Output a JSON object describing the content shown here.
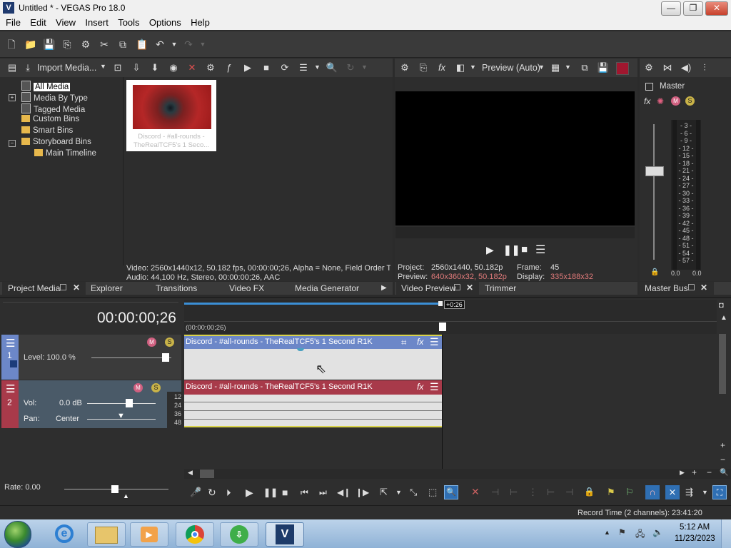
{
  "window": {
    "title": "Untitled * - VEGAS Pro 18.0",
    "app_icon": "V",
    "minimize": "—",
    "maximize": "❐",
    "close": "✕"
  },
  "menu": [
    "File",
    "Edit",
    "View",
    "Insert",
    "Tools",
    "Options",
    "Help"
  ],
  "project_media": {
    "import_label": "Import Media...",
    "tree": [
      {
        "label": "All Media",
        "selected": true
      },
      {
        "label": "Media By Type",
        "expander": "+"
      },
      {
        "label": "Tagged Media"
      },
      {
        "label": "Custom Bins"
      },
      {
        "label": "Smart Bins"
      },
      {
        "label": "Storyboard Bins",
        "expander": "−"
      },
      {
        "label": "Main Timeline"
      }
    ],
    "thumbnail_caption": "Discord - #all-rounds - TheRealTCF5's 1 Seco...",
    "info_video": "Video: 2560x1440x12, 50.182 fps, 00:00:00;26, Alpha = None, Field Order T",
    "info_audio": "Audio: 44,100 Hz, Stereo, 00:00:00;26, AAC"
  },
  "tabs_left": [
    "Project Media",
    "Explorer",
    "Transitions",
    "Video FX",
    "Media Generator"
  ],
  "preview": {
    "mode": "Preview (Auto)",
    "project_label": "Project:",
    "project_value": "2560x1440, 50.182p",
    "preview_label": "Preview:",
    "preview_value": "640x360x32, 50.182p",
    "frame_label": "Frame:",
    "frame_value": "45",
    "display_label": "Display:",
    "display_value": "335x188x32"
  },
  "tabs_mid": [
    "Video Preview",
    "Trimmer"
  ],
  "master": {
    "label": "Master",
    "scale": [
      "3",
      "6",
      "9",
      "12",
      "15",
      "18",
      "21",
      "24",
      "27",
      "30",
      "33",
      "36",
      "39",
      "42",
      "45",
      "48",
      "51",
      "54",
      "57"
    ],
    "left_value": "0.0",
    "right_value": "0.0",
    "tab": "Master Bus"
  },
  "timeline": {
    "timecode": "00:00:00;26",
    "ruler_marker": "+0:26",
    "ruler_time": "(00:00:00;26)",
    "video_track": {
      "number": "1",
      "level": "Level: 100.0 %",
      "clip": "Discord - #all-rounds - TheRealTCF5's 1 Second R1K"
    },
    "audio_track": {
      "number": "2",
      "vol_label": "Vol:",
      "vol_value": "0.0 dB",
      "pan_label": "Pan:",
      "pan_value": "Center",
      "clip": "Discord - #all-rounds - TheRealTCF5's 1 Second R1K",
      "meter": [
        "12",
        "24",
        "36",
        "48"
      ]
    },
    "rate": "Rate: 0.00",
    "record_time": "Record Time (2 channels): 23:41:20"
  },
  "colors": {
    "video_track": "#6c87c8",
    "audio_track": "#a83a4a",
    "clip_body": "#e2e2e2",
    "accent": "#3b8fd6"
  },
  "taskbar": {
    "time": "5:12 AM",
    "date": "11/23/2023"
  }
}
